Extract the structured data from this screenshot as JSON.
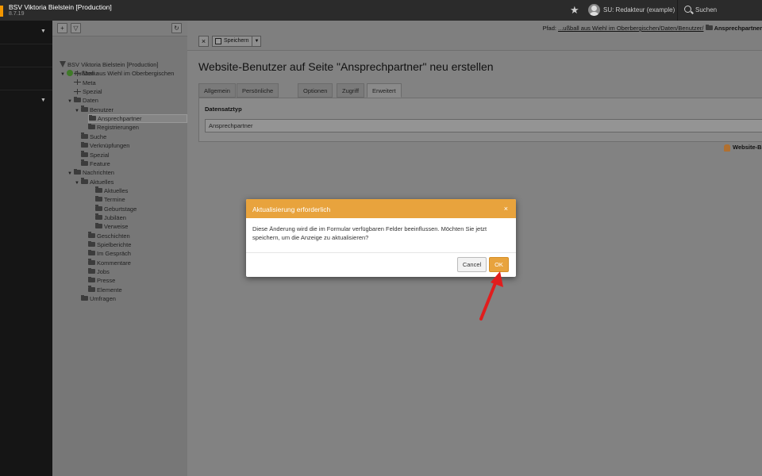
{
  "topbar": {
    "site_title": "BSV Viktoria Bielstein [Production]",
    "version": "8.7.19",
    "user": "SU: Redakteur (example)",
    "search_label": "Suchen",
    "icons": [
      "star-icon",
      "avatar",
      "search-icon"
    ]
  },
  "tree": {
    "root": "BSV Viktoria Bielstein [Production]",
    "site": "Fußball aus Wiehl im Oberbergischen",
    "items": [
      {
        "label": "Menu",
        "icon": "page"
      },
      {
        "label": "Meta",
        "icon": "page"
      },
      {
        "label": "Spezial",
        "icon": "page"
      },
      {
        "label": "Daten",
        "icon": "folder"
      },
      {
        "label": "Benutzer",
        "icon": "folder"
      },
      {
        "label": "Ansprechpartner",
        "icon": "folder",
        "selected": true
      },
      {
        "label": "Registrierungen",
        "icon": "folder"
      },
      {
        "label": "Suche",
        "icon": "folder"
      },
      {
        "label": "Verknüpfungen",
        "icon": "folder"
      },
      {
        "label": "Spezial",
        "icon": "folder"
      },
      {
        "label": "Feature",
        "icon": "folder"
      },
      {
        "label": "Nachrichten",
        "icon": "folder"
      },
      {
        "label": "Aktuelles",
        "icon": "folder"
      },
      {
        "label": "Aktuelles",
        "icon": "folder"
      },
      {
        "label": "Termine",
        "icon": "folder"
      },
      {
        "label": "Geburtstage",
        "icon": "folder"
      },
      {
        "label": "Jubiläen",
        "icon": "folder"
      },
      {
        "label": "Verweise",
        "icon": "folder"
      },
      {
        "label": "Geschichten",
        "icon": "folder"
      },
      {
        "label": "Spielberichte",
        "icon": "folder"
      },
      {
        "label": "Im Gespräch",
        "icon": "folder"
      },
      {
        "label": "Kommentare",
        "icon": "folder"
      },
      {
        "label": "Jobs",
        "icon": "folder"
      },
      {
        "label": "Presse",
        "icon": "folder"
      },
      {
        "label": "Elemente",
        "icon": "folder"
      },
      {
        "label": "Umfragen",
        "icon": "folder"
      }
    ]
  },
  "docheader": {
    "close_symbol": "×",
    "save_label": "Speichern",
    "path_prefix": "Pfad:",
    "path_link": "...ußball aus Wiehl im Oberbergischen/Daten/Benutzer/",
    "path_current": "Ansprechpartner"
  },
  "main": {
    "heading": "Website-Benutzer auf Seite \"Ansprechpartner\" neu erstellen",
    "tabs": [
      "Allgemein",
      "Persönliche Daten",
      "Optionen",
      "Zugriff",
      "Erweitert"
    ],
    "active_tab": "Erweitert",
    "field_label": "Datensatztyp",
    "field_value": "Ansprechpartner",
    "record_info": "Website-B"
  },
  "modal": {
    "title": "Aktualisierung erforderlich",
    "close_symbol": "×",
    "body": "Diese Änderung wird die im Formular verfügbaren Felder beeinflussen. Möchten Sie jetzt speichern, um die Anzeige zu aktualisieren?",
    "cancel_label": "Cancel",
    "ok_label": "OK"
  },
  "colors": {
    "accent": "#e8a33d",
    "logo": "#f49700",
    "arrow": "#e11d1d"
  }
}
